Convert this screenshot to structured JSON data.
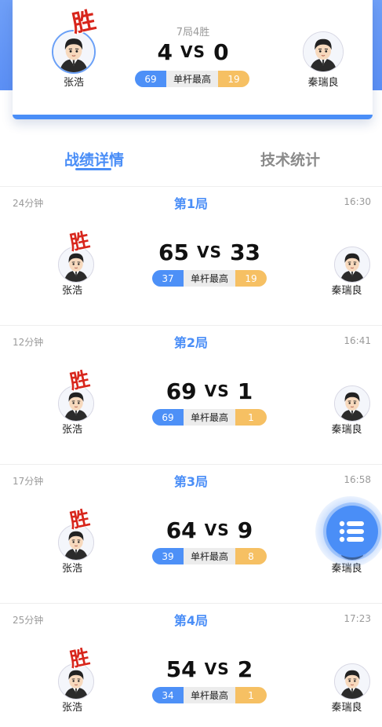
{
  "summary": {
    "frames_info": "7局4胜",
    "left_player": {
      "name": "张浩",
      "score": "4",
      "win_badge": "胜"
    },
    "right_player": {
      "name": "秦瑞良",
      "score": "0"
    },
    "vs": "VS",
    "stat": {
      "left": "69",
      "label": "单杆最高",
      "right": "19"
    }
  },
  "tabs": [
    {
      "label": "战绩详情",
      "active": true
    },
    {
      "label": "技术统计",
      "active": false
    }
  ],
  "frames": [
    {
      "duration": "24分钟",
      "title": "第1局",
      "time": "16:30",
      "left_name": "张浩",
      "left_score": "65",
      "right_name": "秦瑞良",
      "right_score": "33",
      "vs": "VS",
      "break_left": "37",
      "break_label": "单杆最高",
      "break_right": "19",
      "win_badge": "胜"
    },
    {
      "duration": "12分钟",
      "title": "第2局",
      "time": "16:41",
      "left_name": "张浩",
      "left_score": "69",
      "right_name": "秦瑞良",
      "right_score": "1",
      "vs": "VS",
      "break_left": "69",
      "break_label": "单杆最高",
      "break_right": "1",
      "win_badge": "胜"
    },
    {
      "duration": "17分钟",
      "title": "第3局",
      "time": "16:58",
      "left_name": "张浩",
      "left_score": "64",
      "right_name": "秦瑞良",
      "right_score": "9",
      "vs": "VS",
      "break_left": "39",
      "break_label": "单杆最高",
      "break_right": "8",
      "win_badge": "胜"
    },
    {
      "duration": "25分钟",
      "title": "第4局",
      "time": "17:23",
      "left_name": "张浩",
      "left_score": "54",
      "right_name": "秦瑞良",
      "right_score": "2",
      "vs": "VS",
      "break_left": "34",
      "break_label": "单杆最高",
      "break_right": "1",
      "win_badge": "胜"
    }
  ],
  "fab": {
    "icon": "list-menu-icon"
  },
  "colors": {
    "accent": "#4a8ef7",
    "win": "#d8261c",
    "right_bar": "#f6c063"
  }
}
